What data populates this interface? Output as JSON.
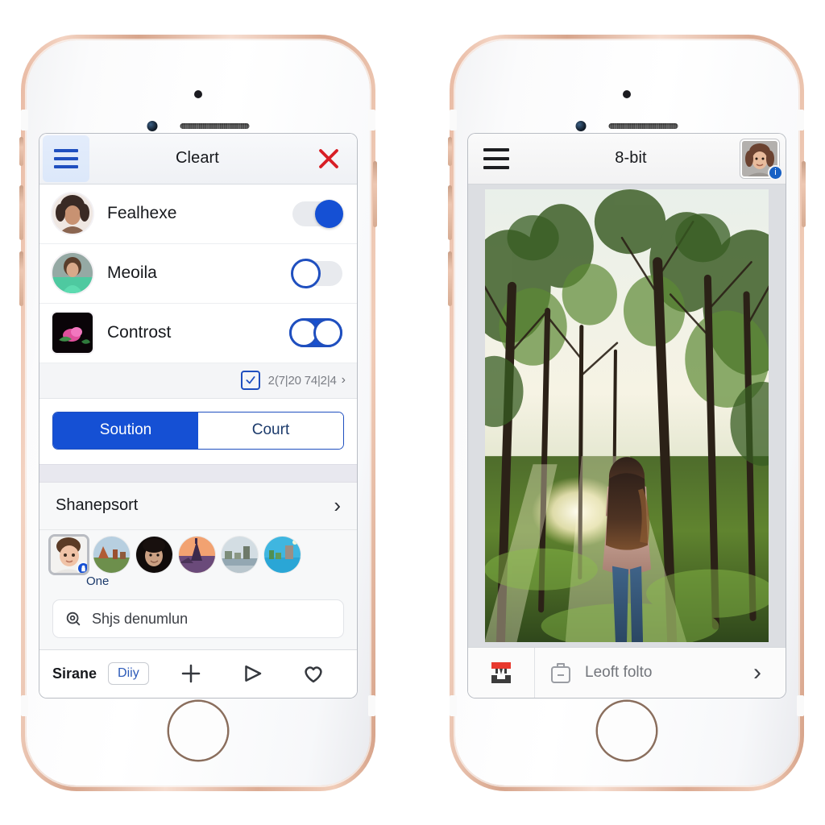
{
  "left_phone": {
    "appbar": {
      "menu_icon": "hamburger-icon",
      "title": "Cleart",
      "close_icon": "close-x-icon",
      "close_color": "#d81f26",
      "menu_color": "#1f4fbf"
    },
    "rows": [
      {
        "label": "Fealhexe",
        "toggle": "on",
        "avatar": "woman-curly-hair"
      },
      {
        "label": "Meoila",
        "toggle": "off",
        "avatar": "woman-green-top"
      },
      {
        "label": "Controst",
        "toggle": "dual",
        "avatar": "pink-flower"
      }
    ],
    "checkrow": {
      "checked": true,
      "text": "2(7|20 74|2|4",
      "chevron": "chevron-right-icon"
    },
    "segmented": {
      "selected_label": "Soution",
      "unselected_label": "Court",
      "accent": "#1550d4"
    },
    "share_section": {
      "title": "Shanepsort",
      "chevron": "chevron-right-icon",
      "thumbs": [
        {
          "name": "child-portrait",
          "selected": true,
          "badge": "lock-badge"
        },
        {
          "name": "desert-rock-landscape",
          "selected": false
        },
        {
          "name": "woman-dark-portrait",
          "selected": false
        },
        {
          "name": "sunset-cathedral",
          "selected": false
        },
        {
          "name": "river-bridge-city",
          "selected": false
        },
        {
          "name": "blue-harbour-city",
          "selected": false
        }
      ],
      "caption": "One"
    },
    "search": {
      "icon": "search-icon",
      "value": "Shjs denumlun"
    },
    "tabbar": {
      "name": "Sirane",
      "pill_label": "Diiy",
      "icons": [
        "plus-icon",
        "play-triangle-icon",
        "heart-icon"
      ]
    }
  },
  "right_phone": {
    "appbar": {
      "menu_icon": "hamburger-icon",
      "title": "8-bit",
      "avatar": "woman-smiling-portrait",
      "avatar_badge": "info-badge",
      "badge_color": "#1760c4"
    },
    "photo": {
      "name": "woman-standing-in-sunlit-forest",
      "alt": "Woman with long hair seen from behind standing in a green forest at sunset"
    },
    "botbar": {
      "left_icon": "red-printer-icon",
      "mid_icon": "briefcase-minus-icon",
      "mid_label": "Leoft folto",
      "chevron": "chevron-right-icon"
    }
  }
}
